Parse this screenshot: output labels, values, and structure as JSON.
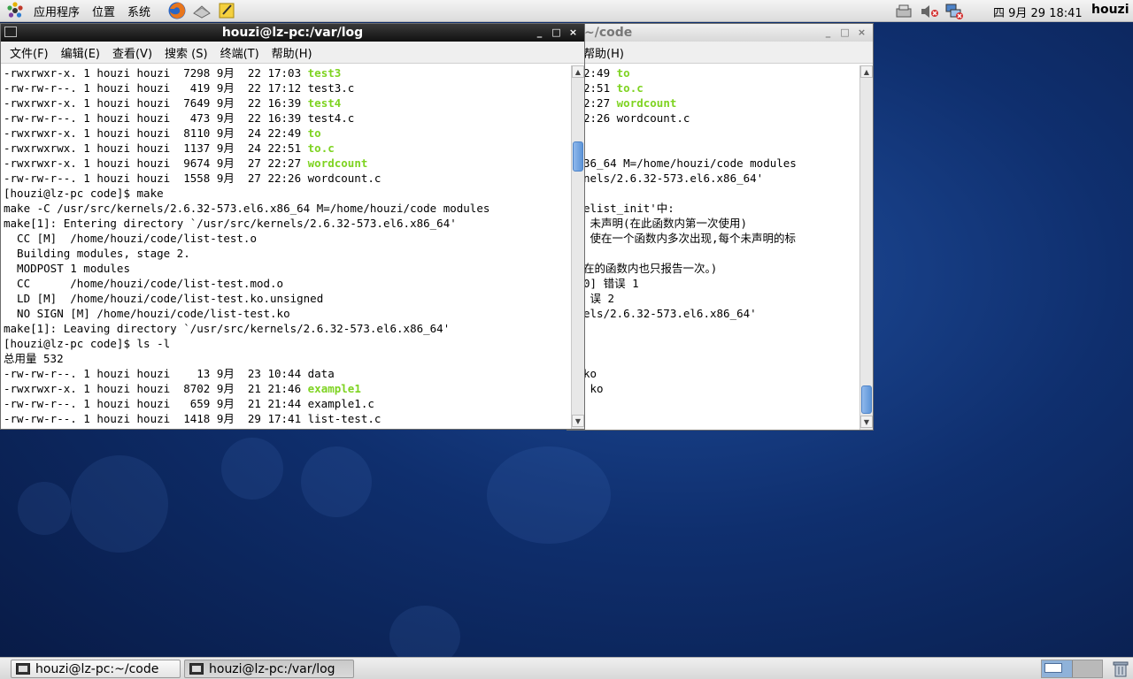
{
  "top_panel": {
    "menus": [
      "应用程序",
      "位置",
      "系统"
    ],
    "launchers": [
      "firefox-icon",
      "mail-icon",
      "notes-icon"
    ],
    "clock": "四 9月 29 18:41",
    "user": "houzi"
  },
  "back_window": {
    "title": "~/code",
    "menu_visible": "帮助(H)",
    "lines": [
      {
        "text": "2:49 ",
        "exe": "to"
      },
      {
        "text": "2:51 ",
        "exe": "to.c"
      },
      {
        "text": "2:27 ",
        "exe": "wordcount"
      },
      {
        "text": "2:26 wordcount.c"
      },
      {
        "text": ""
      },
      {
        "text": ""
      },
      {
        "text": "36_64 M=/home/houzi/code modules"
      },
      {
        "text": "nels/2.6.32-573.el6.x86_64'"
      },
      {
        "text": ""
      },
      {
        "text": "elist_init'中:"
      },
      {
        "text": " 未声明(在此函数内第一次使用)"
      },
      {
        "text": " 使在一个函数内多次出现,每个未声明的标"
      },
      {
        "text": ""
      },
      {
        "text": "在的函数内也只报告一次。)"
      },
      {
        "text": "0] 错误 1"
      },
      {
        "text": " 误 2"
      },
      {
        "text": "els/2.6.32-573.el6.x86_64'"
      },
      {
        "text": ""
      },
      {
        "text": ""
      },
      {
        "text": ""
      },
      {
        "text": "ko"
      },
      {
        "text": " ko"
      }
    ]
  },
  "front_window": {
    "title": "houzi@lz-pc:/var/log",
    "menus": [
      "文件(F)",
      "编辑(E)",
      "查看(V)",
      "搜索 (S)",
      "终端(T)",
      "帮助(H)"
    ],
    "lines": [
      {
        "text": "-rwxrwxr-x. 1 houzi houzi  7298 9月  22 17:03 ",
        "exe": "test3"
      },
      {
        "text": "-rw-rw-r--. 1 houzi houzi   419 9月  22 17:12 test3.c"
      },
      {
        "text": "-rwxrwxr-x. 1 houzi houzi  7649 9月  22 16:39 ",
        "exe": "test4"
      },
      {
        "text": "-rw-rw-r--. 1 houzi houzi   473 9月  22 16:39 test4.c"
      },
      {
        "text": "-rwxrwxr-x. 1 houzi houzi  8110 9月  24 22:49 ",
        "exe": "to"
      },
      {
        "text": "-rwxrwxrwx. 1 houzi houzi  1137 9月  24 22:51 ",
        "exe": "to.c"
      },
      {
        "text": "-rwxrwxr-x. 1 houzi houzi  9674 9月  27 22:27 ",
        "exe": "wordcount"
      },
      {
        "text": "-rw-rw-r--. 1 houzi houzi  1558 9月  27 22:26 wordcount.c"
      },
      {
        "text": "[houzi@lz-pc code]$ make"
      },
      {
        "text": "make -C /usr/src/kernels/2.6.32-573.el6.x86_64 M=/home/houzi/code modules"
      },
      {
        "text": "make[1]: Entering directory `/usr/src/kernels/2.6.32-573.el6.x86_64'"
      },
      {
        "text": "  CC [M]  /home/houzi/code/list-test.o"
      },
      {
        "text": "  Building modules, stage 2."
      },
      {
        "text": "  MODPOST 1 modules"
      },
      {
        "text": "  CC      /home/houzi/code/list-test.mod.o"
      },
      {
        "text": "  LD [M]  /home/houzi/code/list-test.ko.unsigned"
      },
      {
        "text": "  NO SIGN [M] /home/houzi/code/list-test.ko"
      },
      {
        "text": "make[1]: Leaving directory `/usr/src/kernels/2.6.32-573.el6.x86_64'"
      },
      {
        "text": "[houzi@lz-pc code]$ ls -l"
      },
      {
        "text": "总用量 532"
      },
      {
        "text": "-rw-rw-r--. 1 houzi houzi    13 9月  23 10:44 data"
      },
      {
        "text": "-rwxrwxr-x. 1 houzi houzi  8702 9月  21 21:46 ",
        "exe": "example1"
      },
      {
        "text": "-rw-rw-r--. 1 houzi houzi   659 9月  21 21:44 example1.c"
      },
      {
        "text": "-rw-rw-r--. 1 houzi houzi  1418 9月  29 17:41 list-test.c"
      }
    ]
  },
  "window_buttons": {
    "minimize": "_",
    "maximize": "□",
    "close": "×"
  },
  "taskbar": {
    "tasks": [
      "houzi@lz-pc:~/code",
      "houzi@lz-pc:/var/log"
    ]
  },
  "colors": {
    "executable": "#7ed321",
    "scroll_thumb": "#5e95d8"
  }
}
